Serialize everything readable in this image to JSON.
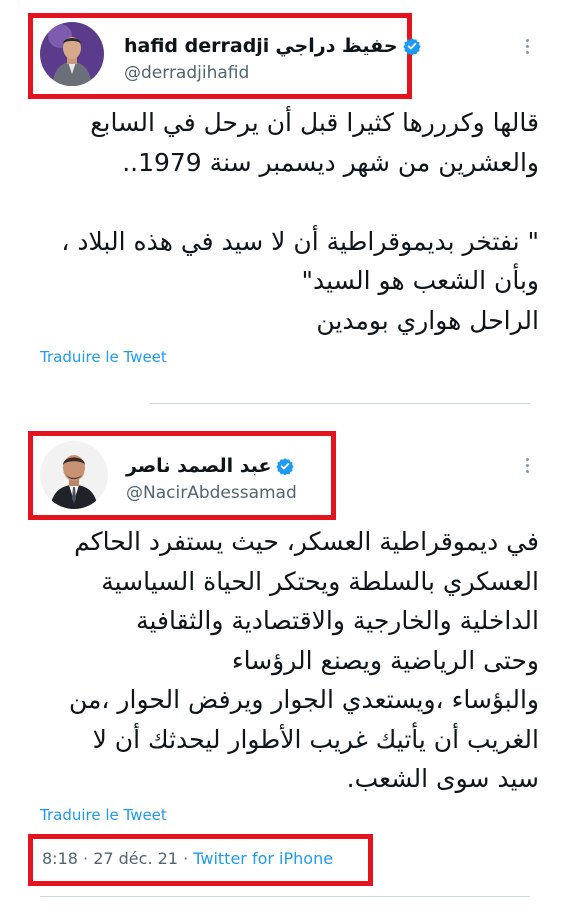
{
  "tweet1": {
    "display_name": "hafid derradji",
    "display_name_ar": "حفيظ دراجي",
    "handle": "@derradjihafid",
    "body_lines": [
      "قالها وكرررها كثيرا قبل أن يرحل في السابع",
      "والعشرين من شهر ديسمبر سنة 1979..",
      "",
      "\" نفتخر بديموقراطية أن لا سيد في هذه البلاد ،",
      "وبأن الشعب هو السيد\"",
      "الراحل هواري بومدين"
    ],
    "translate_label": "Traduire le Tweet"
  },
  "tweet2": {
    "display_name": "عبد الصمد ناصر",
    "handle": "@NacirAbdessamad",
    "body_lines": [
      "في ديموقراطية العسكر، حيث يستفرد الحاكم",
      "العسكري بالسلطة ويحتكر الحياة السياسية",
      "الداخلية والخارجية والاقتصادية والثقافية",
      "وحتى الرياضية ويصنع الرؤساء",
      "والبؤساء ،ويستعدي الجوار ويرفض الحوار ،من",
      "الغريب أن يأتيك غريب الأطوار ليحدثك أن لا",
      "سيد سوى الشعب."
    ],
    "translate_label": "Traduire le Tweet",
    "time": "8:18",
    "date": "27 déc. 21",
    "source": "Twitter for iPhone"
  },
  "colors": {
    "highlight_box": "#e4141e",
    "link": "#1d9bf0",
    "verified": "#1d9bf0",
    "secondary_text": "#536471"
  },
  "icons": {
    "verified": "verified-badge-icon",
    "more": "more-options-icon"
  }
}
